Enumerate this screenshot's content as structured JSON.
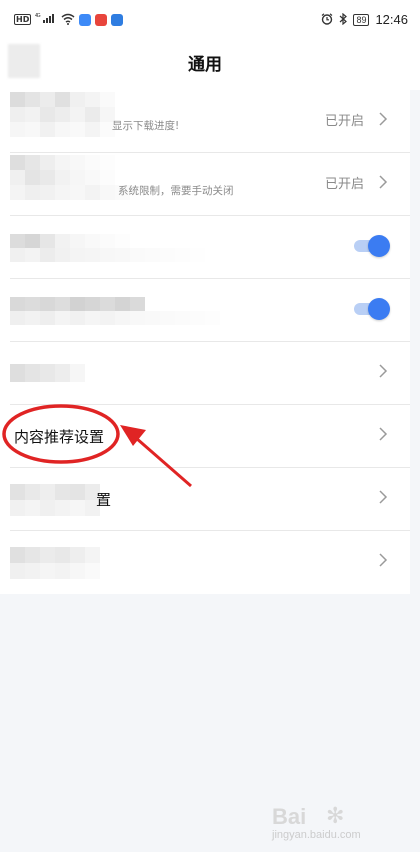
{
  "status_bar": {
    "network": "4G",
    "hd_label": "HD",
    "battery": "89",
    "time": "12:46",
    "icons": [
      "hd-icon",
      "signal-icon",
      "wifi-icon",
      "app-notification-icon",
      "alarm-icon",
      "bluetooth-icon",
      "battery-icon"
    ]
  },
  "header": {
    "title": "通用"
  },
  "rows": [
    {
      "subtitle_visible": "显示下载进度!",
      "status": "已开启"
    },
    {
      "subtitle_visible": "系统限制，需要手动关闭",
      "status": "已开启"
    },
    {
      "toggle_on": true
    },
    {
      "toggle_on": true
    },
    {},
    {
      "title": "内容推荐设置"
    },
    {
      "title_visible_fragment": "置"
    },
    {}
  ],
  "colors": {
    "accent": "#3b7cf2",
    "annotation": "#e02424",
    "background": "#f4f6f9"
  },
  "watermark": {
    "line1": "Bai",
    "line2": "jingyan.baidu.com"
  }
}
